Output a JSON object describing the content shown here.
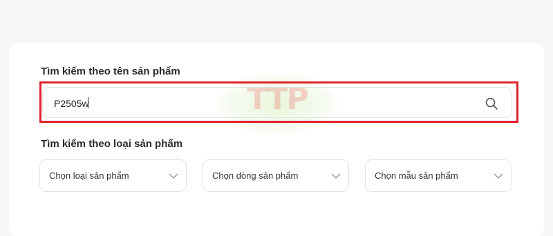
{
  "search_by_name": {
    "label": "Tìm kiếm theo tên sản phẩm",
    "input_value": "P2505w",
    "icon": "search-icon"
  },
  "search_by_type": {
    "label": "Tìm kiếm theo loại sản phẩm",
    "selects": [
      {
        "label": "Chọn loại sản phẩm"
      },
      {
        "label": "Chọn dòng sản phẩm"
      },
      {
        "label": "Chọn mẫu sản phẩm"
      }
    ]
  },
  "watermark": {
    "text": "TTP"
  },
  "colors": {
    "highlight_border": "#e0202b",
    "page_background": "#f6f6f6",
    "card_background": "#ffffff"
  }
}
